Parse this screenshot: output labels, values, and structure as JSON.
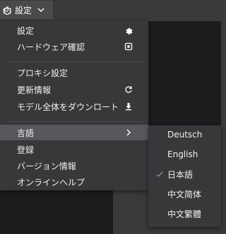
{
  "toolbar": {
    "settings_label": "設定",
    "icon": "gear-icon",
    "chevron": "chevron-down-icon"
  },
  "menu": {
    "items": [
      {
        "label": "設定",
        "icon": "gear-icon"
      },
      {
        "label": "ハードウェア確認",
        "icon": "chip-icon"
      },
      {
        "label": "プロキシ設定",
        "icon": ""
      },
      {
        "label": "更新情報",
        "icon": "refresh-icon"
      },
      {
        "label": "モデル全体をダウンロート",
        "icon": "download-icon"
      },
      {
        "label": "言語",
        "icon": "chevron-right-icon"
      },
      {
        "label": "登録",
        "icon": ""
      },
      {
        "label": "バージョン情報",
        "icon": ""
      },
      {
        "label": "オンラインヘルプ",
        "icon": ""
      }
    ]
  },
  "language_submenu": {
    "items": [
      {
        "label": "Deutsch",
        "selected": false
      },
      {
        "label": "English",
        "selected": false
      },
      {
        "label": "日本語",
        "selected": true
      },
      {
        "label": "中文简体",
        "selected": false
      },
      {
        "label": "中文繁體",
        "selected": false
      }
    ]
  },
  "colors": {
    "menu_bg": "#38383b",
    "highlight": "#58585c",
    "panel_dark": "#1c1c1f"
  }
}
